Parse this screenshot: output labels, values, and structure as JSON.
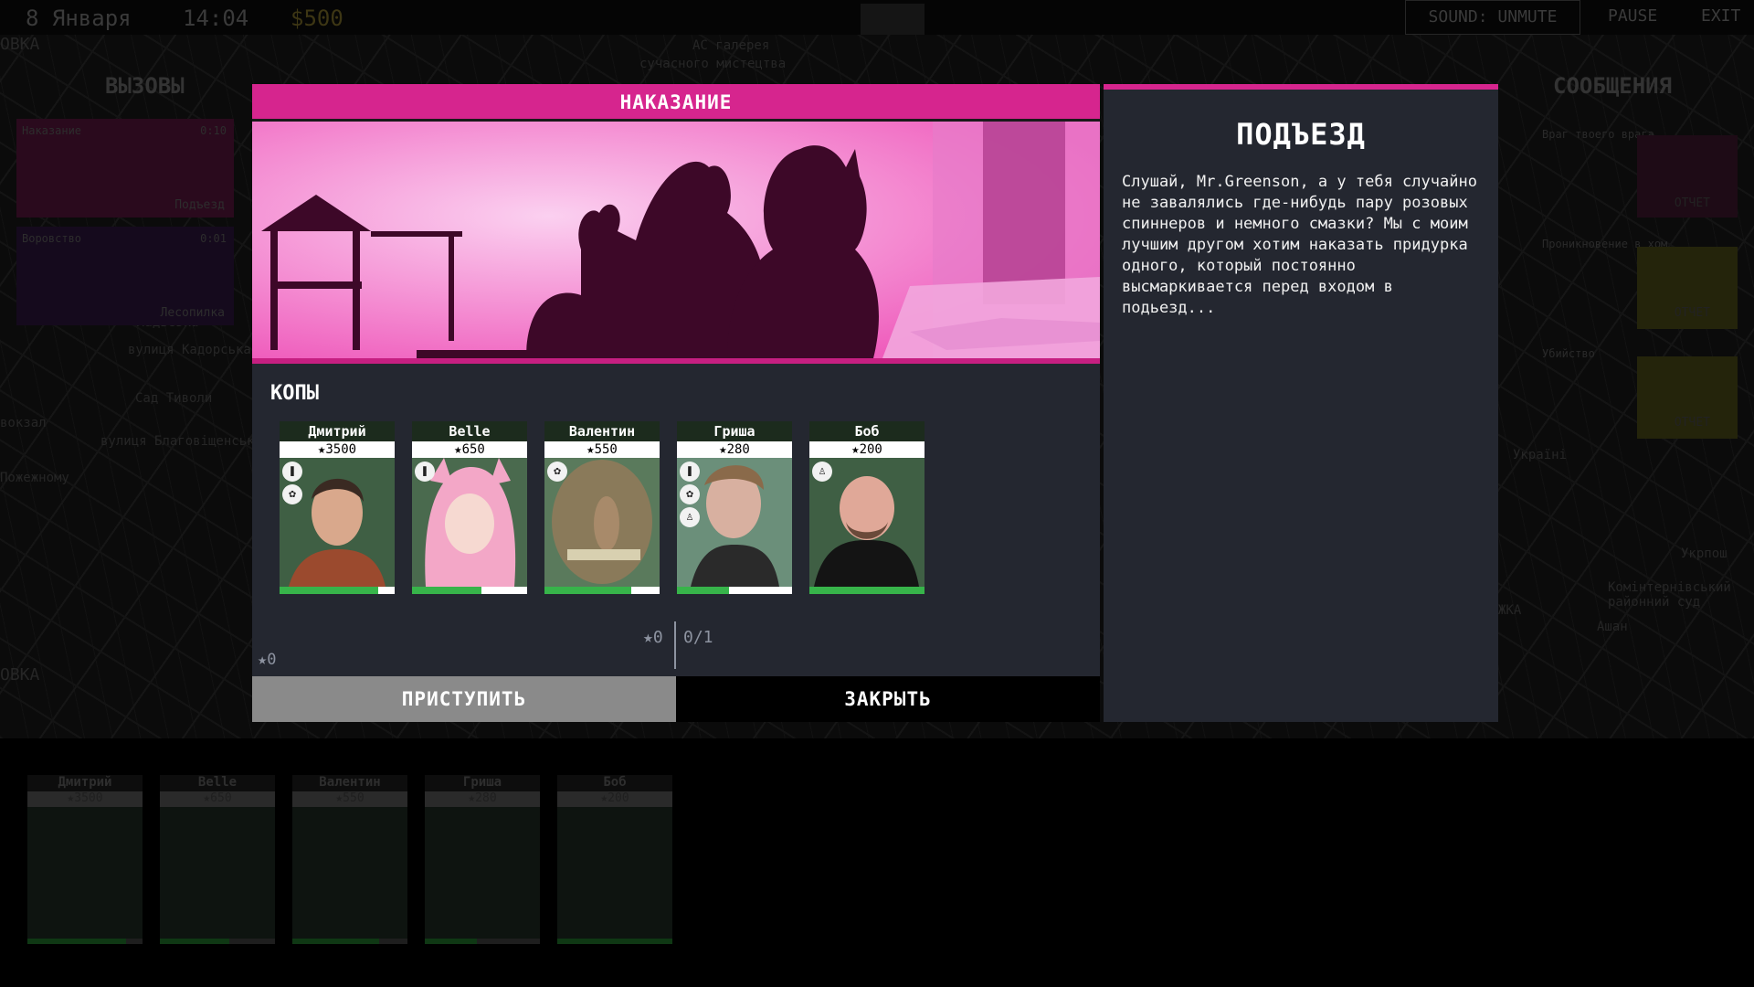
{
  "topbar": {
    "date": "8 Января",
    "time": "14:04",
    "money": "$500",
    "sound_label": "SOUND: UNMUTE",
    "pause_label": "PAUSE",
    "exit_label": "EXIT"
  },
  "map_labels": [
    "ОВКА",
    "АС галерея",
    "сучасного мистецтва",
    "Ладьевка",
    "вулиця Кадорська",
    "Сад Тиволи",
    "вокзал",
    "вулиця Благовіщенська",
    "Пожежному",
    "ОВКА",
    "Ашан",
    "Комінтернівський районний суд",
    "Укрпош",
    "Україні",
    "ЖКА"
  ],
  "calls_panel": {
    "title": "ВЫЗОВЫ",
    "items": [
      {
        "name": "Наказание",
        "timer": "0:10",
        "location": "Подъезд",
        "color": "#3a0b26"
      },
      {
        "name": "Воровство",
        "timer": "0:01",
        "location": "Лесопилка",
        "color": "#1d0b26"
      }
    ]
  },
  "messages_panel": {
    "title": "СООБЩЕНИЯ",
    "items": [
      {
        "name": "Враг твоего врага",
        "report": "ОТЧЕТ",
        "color": "#2b0c1d"
      },
      {
        "name": "Проникновение в хом",
        "report": "ОТЧЕТ",
        "color": "#2a2a0c"
      },
      {
        "name": "Убийство",
        "report": "ОТЧЕТ",
        "color": "#2a2a0c"
      }
    ]
  },
  "mission": {
    "header": "НАКАЗАНИЕ",
    "subtitle": "КОПЫ",
    "selected_stars": "★0",
    "slots": "0/1",
    "team_stars": "★0",
    "start_label": "ПРИСТУПИТЬ",
    "close_label": "ЗАКРЫТЬ"
  },
  "cops": [
    {
      "name": "Дмитрий",
      "score": "★3500",
      "health": 0.86,
      "icons": [
        "bottle-icon",
        "leaf-icon"
      ]
    },
    {
      "name": "Belle",
      "score": "★650",
      "health": 0.6,
      "icons": [
        "bottle-icon"
      ]
    },
    {
      "name": "Валентин",
      "score": "★550",
      "health": 0.75,
      "icons": [
        "leaf-icon"
      ]
    },
    {
      "name": "Гриша",
      "score": "★280",
      "health": 0.45,
      "icons": [
        "bottle-icon",
        "leaf-icon",
        "running-person-icon"
      ]
    },
    {
      "name": "Боб",
      "score": "★200",
      "health": 1.0,
      "icons": [
        "running-person-icon"
      ]
    }
  ],
  "description": {
    "title": "ПОДЪЕЗД",
    "text": "Слушай, Mr.Greenson, а у тебя случайно не завалялись где-нибудь пару розовых спиннеров и немного смазки? Мы с моим лучшим другом хотим наказать придурка одного, который постоянно высмаркивается перед входом в подьезд..."
  },
  "colors": {
    "accent": "#d6258e",
    "panel": "#242730",
    "health": "#37b44a",
    "card": "#3b563d"
  }
}
